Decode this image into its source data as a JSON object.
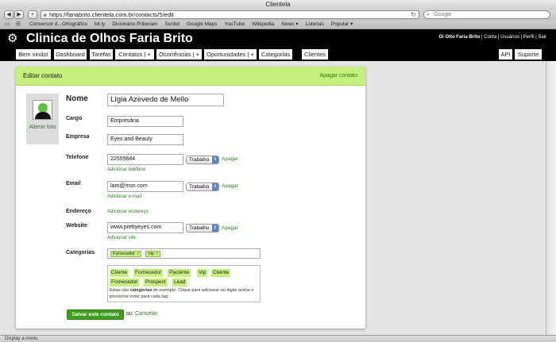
{
  "window": {
    "title": "Clientela"
  },
  "toolbar": {
    "back": "◀",
    "forward": "▶",
    "add": "+",
    "url": "https://fariabrito.clientela.com.br/contacts/5/edit",
    "search_placeholder": "Google"
  },
  "bookmarks": [
    "Conversor d...Ortográfico",
    "bit.ly",
    "Dicionário Priberam",
    "Scribd",
    "Google Maps",
    "YouTube",
    "Wikipedia",
    "News ▾",
    "Loterias",
    "Popular ▾"
  ],
  "app": {
    "title": "Clinica de Olhos Faria Brito",
    "greeting": "Oi Otto Faria Brito",
    "links": [
      "Conta",
      "Usuários",
      "Perfil",
      "Sair"
    ]
  },
  "tabs": [
    "Bem vindo!",
    "Dashboard",
    "Tarefas",
    "Contatos | +",
    "Ocorrências | +",
    "Oportunidades | +",
    "Categorias",
    "Clientes",
    "API",
    "Suporte"
  ],
  "card": {
    "title": "Editar contato",
    "delete_label": "Apagar contato",
    "avatar_link": "Alterar foto"
  },
  "form": {
    "name_label": "Nome",
    "name_value": "Lígia Azevedo de Mello",
    "cargo_label": "Cargo",
    "cargo_value": "Empresária",
    "empresa_label": "Empresa",
    "empresa_value": "Eyes and Beauty",
    "telefone_label": "Telefone",
    "telefone_value": "22559844",
    "telefone_type": "Trabalho",
    "telefone_add": "Adicionar telefone",
    "email_label": "Email",
    "email_value": "lam@msn.com",
    "email_type": "Trabalho",
    "email_add": "Adicionar e-mail",
    "endereco_label": "Endereço",
    "endereco_add": "Adicionar endereço",
    "website_label": "Website",
    "website_value": "www.prettyeyes.com",
    "website_type": "Trabalho",
    "website_add": "Adicionar site",
    "delete_label": "Apagar",
    "categorias_label": "Categorias",
    "selected_tags": [
      "Fornecedor",
      "Vip"
    ],
    "suggested_tags": [
      "Cliente",
      "Fornecedor",
      "Paciente",
      "Vip",
      "Cliente",
      "Fornecedor",
      "Prospect",
      "Lead"
    ],
    "note_prefix": "Estas são ",
    "note_bold": "categorias",
    "note_suffix": " de exemplo. Clique para adicionar ou digite acima e pressione enter para cada tag.",
    "save_label": "Salvar este contato",
    "or_label": "ou",
    "cancel_label": "Cancelar"
  },
  "status": {
    "text": "Display a menu"
  }
}
